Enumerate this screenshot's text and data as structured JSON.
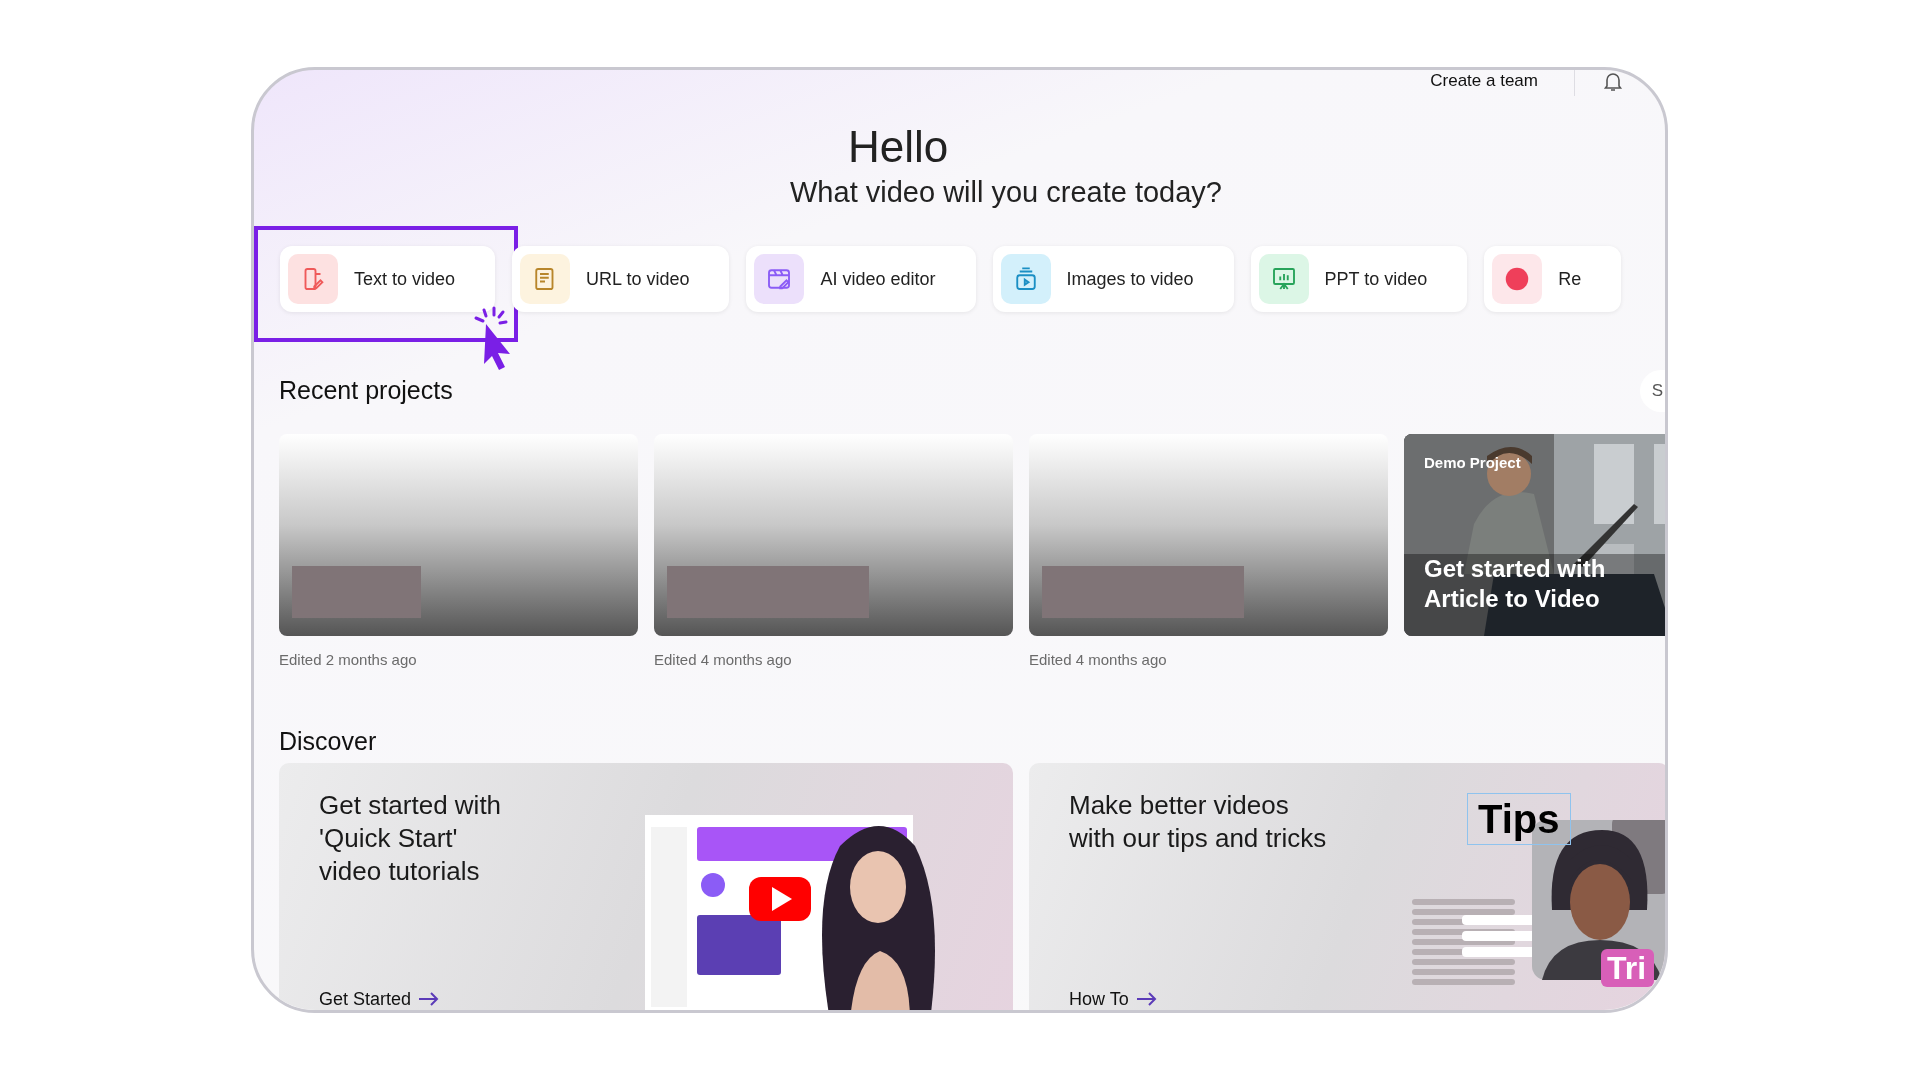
{
  "header": {
    "team_link": "Create a team"
  },
  "greeting": {
    "title": "Hello",
    "subtitle": "What video will you create today?"
  },
  "actions": [
    {
      "label": "Text to video",
      "kind": "text",
      "highlighted": true
    },
    {
      "label": "URL to video",
      "kind": "url",
      "highlighted": false
    },
    {
      "label": "AI video editor",
      "kind": "editor",
      "highlighted": false
    },
    {
      "label": "Images to video",
      "kind": "images",
      "highlighted": false
    },
    {
      "label": "PPT to video",
      "kind": "ppt",
      "highlighted": false
    },
    {
      "label": "Re",
      "kind": "record",
      "highlighted": false
    }
  ],
  "recent_projects": {
    "title": "Recent projects",
    "show_all": "S",
    "projects": [
      {
        "kind": "blank",
        "caption": "Edited 2 months ago"
      },
      {
        "kind": "blank",
        "caption": "Edited 4 months ago"
      },
      {
        "kind": "blank",
        "caption": "Edited 4 months ago"
      },
      {
        "kind": "demo",
        "badge": "Demo Project",
        "title_lines": [
          "Get started with",
          "Article to Video"
        ]
      }
    ]
  },
  "discover": {
    "title": "Discover",
    "cards": [
      {
        "kind": "tutorials",
        "title_lines": [
          "Get started with",
          "'Quick Start'",
          "video tutorials"
        ],
        "link": "Get Started"
      },
      {
        "kind": "tips",
        "title_lines": [
          "Make better videos",
          "with our tips and tricks"
        ],
        "link": "How To",
        "tag": "Tips",
        "badge": "Tri"
      }
    ]
  }
}
